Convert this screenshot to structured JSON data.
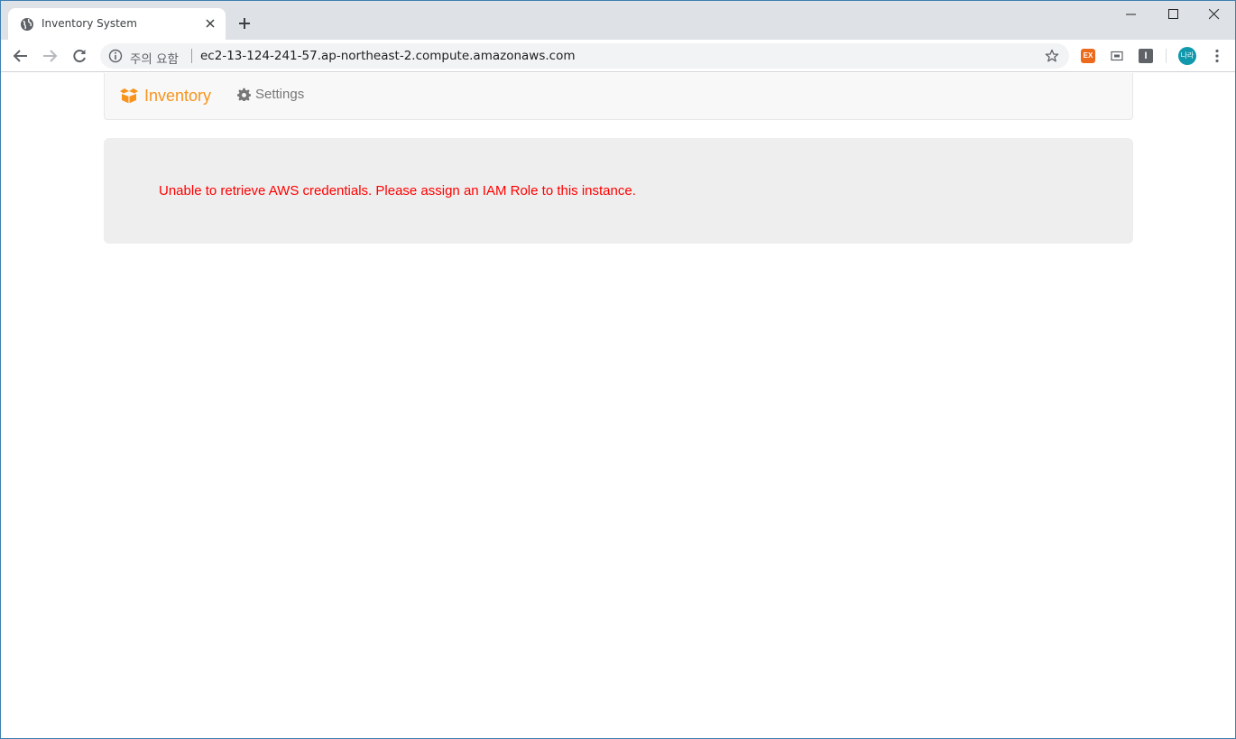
{
  "browser": {
    "tab_title": "Inventory System",
    "security_label": "주의 요함",
    "url": "ec2-13-124-241-57.ap-northeast-2.compute.amazonaws.com",
    "extensions": {
      "ex_label": "EX",
      "i_label": "I"
    },
    "profile_label": "나라"
  },
  "navbar": {
    "brand": "Inventory",
    "settings": "Settings"
  },
  "alert": {
    "message": "Unable to retrieve AWS credentials. Please assign an IAM Role to this instance."
  },
  "colors": {
    "brand": "#f7941d",
    "error": "#ff0000",
    "jumbotron": "#eeeeee",
    "navbar_bg": "#f8f8f8"
  },
  "icons": [
    "globe-icon",
    "close-icon",
    "plus-icon",
    "minimize-icon",
    "maximize-icon",
    "window-close-icon",
    "back-arrow-icon",
    "forward-arrow-icon",
    "reload-icon",
    "info-icon",
    "star-icon",
    "cube-icon",
    "gear-icon",
    "kebab-menu-icon"
  ]
}
